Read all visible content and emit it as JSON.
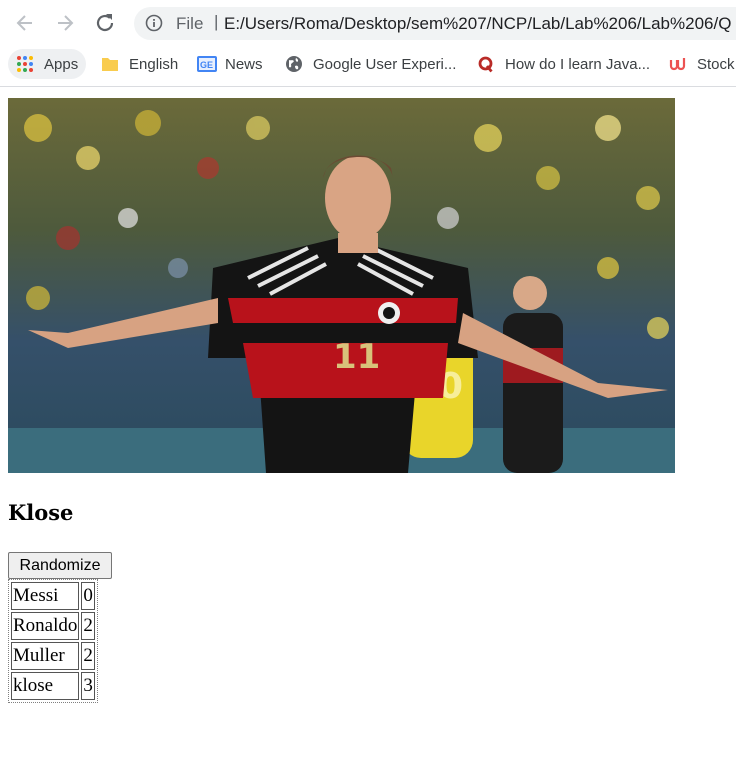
{
  "browser": {
    "omnibox": {
      "scheme": "File",
      "url": "E:/Users/Roma/Desktop/sem%207/NCP/Lab/Lab%206/Lab%206/Q"
    },
    "bookmarks": [
      {
        "label": "Apps",
        "icon": "apps-grid-icon"
      },
      {
        "label": "English",
        "icon": "folder-icon"
      },
      {
        "label": "News",
        "icon": "google-news-icon"
      },
      {
        "label": "Google User Experi...",
        "icon": "globe-icon"
      },
      {
        "label": "How do I learn Java...",
        "icon": "quora-icon"
      },
      {
        "label": "Stock",
        "icon": "udemy-icon"
      }
    ]
  },
  "page": {
    "player_name": "Klose",
    "button_label": "Randomize",
    "jersey_number": "11",
    "table": [
      {
        "name": "Messi",
        "score": "0"
      },
      {
        "name": "Ronaldo",
        "score": "2"
      },
      {
        "name": "Muller",
        "score": "2"
      },
      {
        "name": "klose",
        "score": "3"
      }
    ]
  },
  "colors": {
    "chrome_bg": "#ffffff",
    "omnibox_bg": "#f1f3f4",
    "jersey_black": "#141414",
    "jersey_red": "#b8121b"
  }
}
